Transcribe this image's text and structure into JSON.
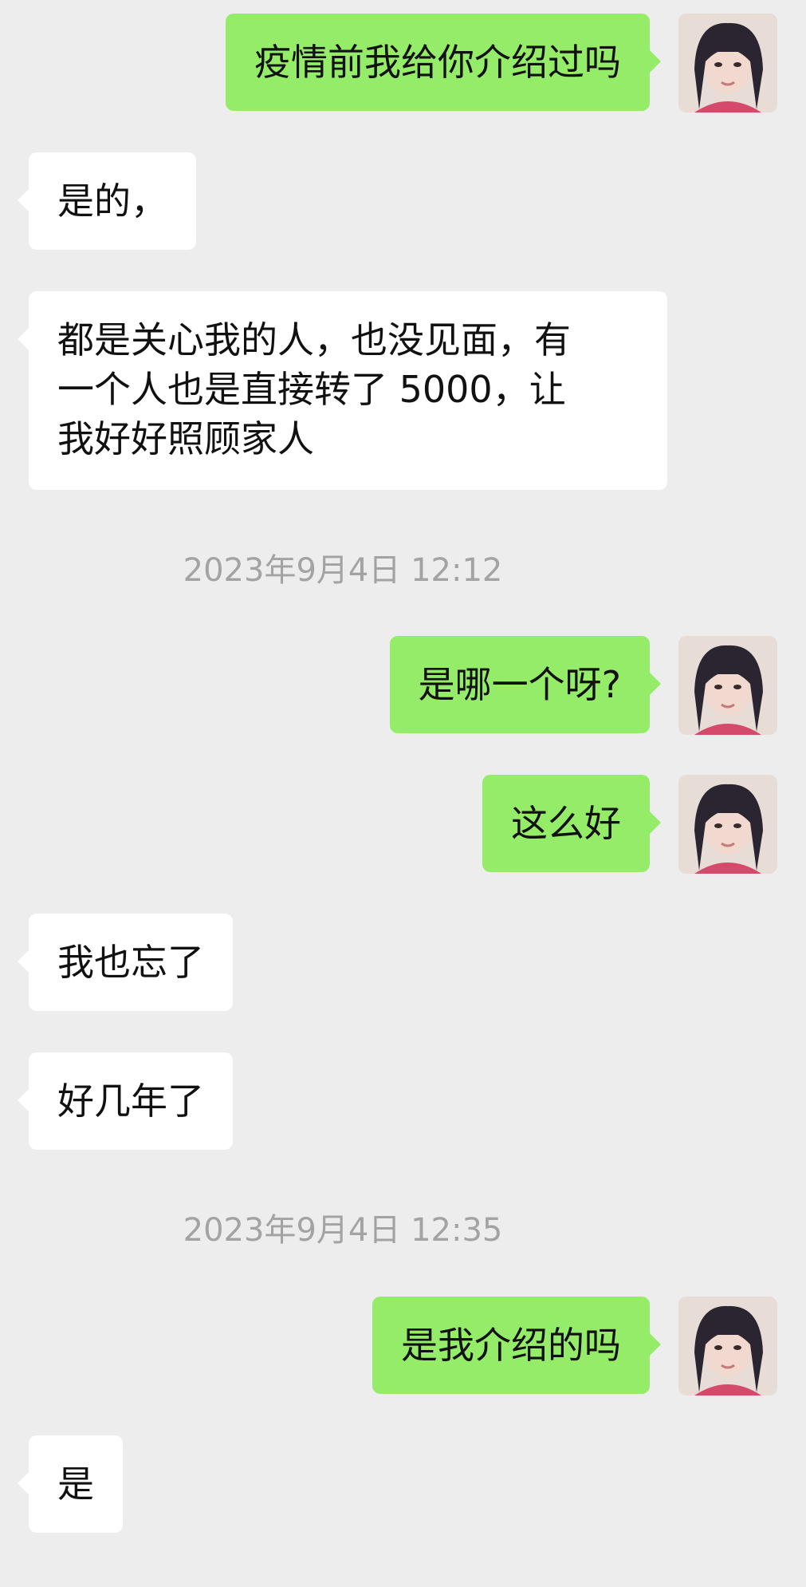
{
  "chat": {
    "messages": [
      {
        "side": "out",
        "text": "疫情前我给你介绍过吗"
      },
      {
        "side": "in",
        "text": "是的，"
      },
      {
        "side": "in",
        "lines": [
          "都是关心我的人，也没见面，有",
          "一个人也是直接转了 5000，让",
          "我好好照顾家人"
        ]
      },
      {
        "side": "out",
        "text": "是哪一个呀?"
      },
      {
        "side": "out",
        "text": "这么好"
      },
      {
        "side": "in",
        "text": "我也忘了"
      },
      {
        "side": "in",
        "text": "好几年了"
      },
      {
        "side": "out",
        "text": "是我介绍的吗"
      },
      {
        "side": "in",
        "text": "是"
      }
    ],
    "timestamps": [
      "2023年9月4日 12:12",
      "2023年9月4日 12:35"
    ],
    "avatar_icon": "user-avatar-photo"
  },
  "colors": {
    "background": "#ededed",
    "outgoing_bubble": "#95ec69",
    "incoming_bubble": "#ffffff",
    "timestamp_text": "#a3a3a3"
  }
}
